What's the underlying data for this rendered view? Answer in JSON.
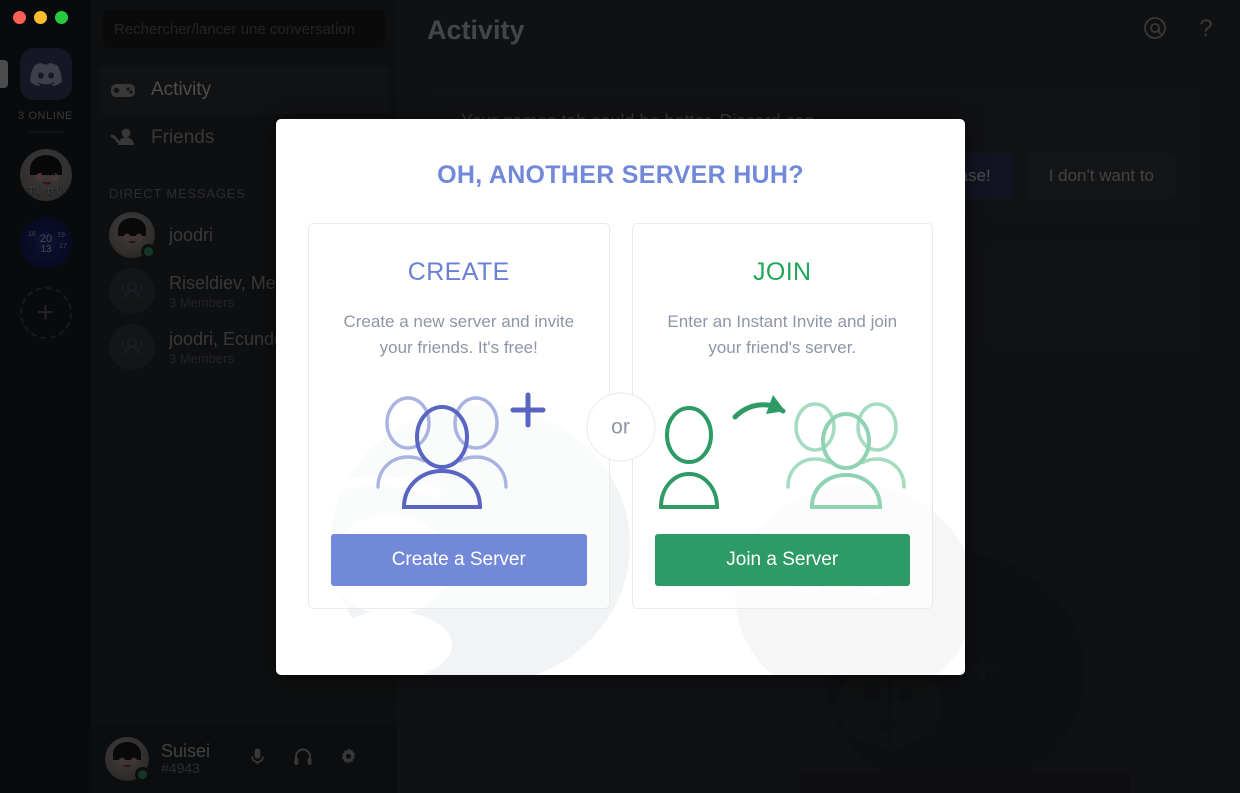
{
  "window": {
    "traffic_lights": [
      "close",
      "minimize",
      "maximize"
    ],
    "colors": {
      "close": "#ff5f57",
      "minimize": "#ffbd2e",
      "maximize": "#28c840",
      "brand_blurple": "#7289da",
      "brand_green": "#2e9a65",
      "title_blue": "#7289da",
      "join_green": "#23a55a",
      "online_green": "#43b581"
    }
  },
  "rail": {
    "home_icon": "discord-logo-icon",
    "online_label": "3 ONLINE",
    "servers": [
      {
        "name": "すいせい",
        "icon": "anime-avatar-icon"
      },
      {
        "name": "d20",
        "icon": "dice-d20-icon",
        "face_numbers": [
          "16",
          "19",
          "20",
          "13",
          "17"
        ]
      }
    ],
    "add_server_label": "+"
  },
  "sidebar": {
    "search": {
      "placeholder": "Rechercher/lancer une conversation",
      "value": ""
    },
    "nav": [
      {
        "label": "Activity",
        "icon": "gamepad-icon",
        "active": true
      },
      {
        "label": "Friends",
        "icon": "friends-icon",
        "active": false
      }
    ],
    "section_label": "DIRECT MESSAGES",
    "dms": [
      {
        "name": "joodri",
        "sub": "",
        "avatar": "user-photo-icon",
        "status": "online"
      },
      {
        "name": "Riseldiev, Me",
        "sub": "3 Members",
        "avatar": "group-icon",
        "status": ""
      },
      {
        "name": "joodri, Ecundo",
        "sub": "3 Members",
        "avatar": "group-icon",
        "status": ""
      }
    ],
    "user": {
      "name": "Suisei",
      "tag": "#4943",
      "status": "online",
      "icons": [
        "microphone-icon",
        "headphones-icon",
        "gear-icon"
      ]
    }
  },
  "main": {
    "title": "Activity",
    "header_icons": [
      "mention-icon",
      "help-icon"
    ],
    "banner": {
      "text": "Your games tab could be better. Discord can",
      "primary_label": "ase!",
      "secondary_label": "I don't want to"
    }
  },
  "modal": {
    "title": "OH, ANOTHER SERVER HUH?",
    "divider_label": "or",
    "cards": [
      {
        "heading": "CREATE",
        "description": "Create a new server and invite your friends. It's free!",
        "art_icon": "group-plus-icon",
        "button_label": "Create a Server"
      },
      {
        "heading": "JOIN",
        "description": "Enter an Instant Invite and join your friend's server.",
        "art_icon": "person-arrow-group-icon",
        "button_label": "Join a Server"
      }
    ]
  }
}
